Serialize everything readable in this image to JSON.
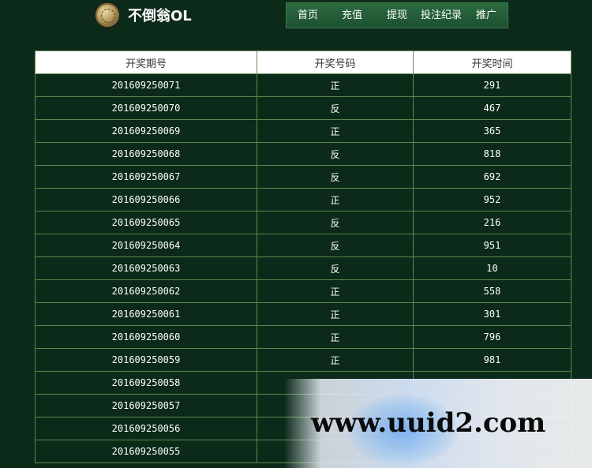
{
  "site": {
    "title": "不倒翁OL"
  },
  "nav": {
    "items": [
      {
        "label": "首页"
      },
      {
        "label": "充值"
      },
      {
        "label": "提现"
      },
      {
        "label": "投注纪录"
      },
      {
        "label": "推广"
      }
    ]
  },
  "table": {
    "headers": [
      "开奖期号",
      "开奖号码",
      "开奖时间"
    ],
    "rows": [
      {
        "period": "201609250071",
        "code": "正",
        "time": "291"
      },
      {
        "period": "201609250070",
        "code": "反",
        "time": "467"
      },
      {
        "period": "201609250069",
        "code": "正",
        "time": "365"
      },
      {
        "period": "201609250068",
        "code": "反",
        "time": "818"
      },
      {
        "period": "201609250067",
        "code": "反",
        "time": "692"
      },
      {
        "period": "201609250066",
        "code": "正",
        "time": "952"
      },
      {
        "period": "201609250065",
        "code": "反",
        "time": "216"
      },
      {
        "period": "201609250064",
        "code": "反",
        "time": "951"
      },
      {
        "period": "201609250063",
        "code": "反",
        "time": "10"
      },
      {
        "period": "201609250062",
        "code": "正",
        "time": "558"
      },
      {
        "period": "201609250061",
        "code": "正",
        "time": "301"
      },
      {
        "period": "201609250060",
        "code": "正",
        "time": "796"
      },
      {
        "period": "201609250059",
        "code": "正",
        "time": "981"
      },
      {
        "period": "201609250058",
        "code": "",
        "time": ""
      },
      {
        "period": "201609250057",
        "code": "",
        "time": ""
      },
      {
        "period": "201609250056",
        "code": "",
        "time": ""
      },
      {
        "period": "201609250055",
        "code": "",
        "time": ""
      }
    ]
  },
  "watermark": {
    "text": "www.uuid2.com"
  },
  "colors": {
    "background": "#0b2a1a",
    "nav_bar": "#1d5030",
    "table_border": "#5c8a4a",
    "header_bg": "#ffffff"
  }
}
